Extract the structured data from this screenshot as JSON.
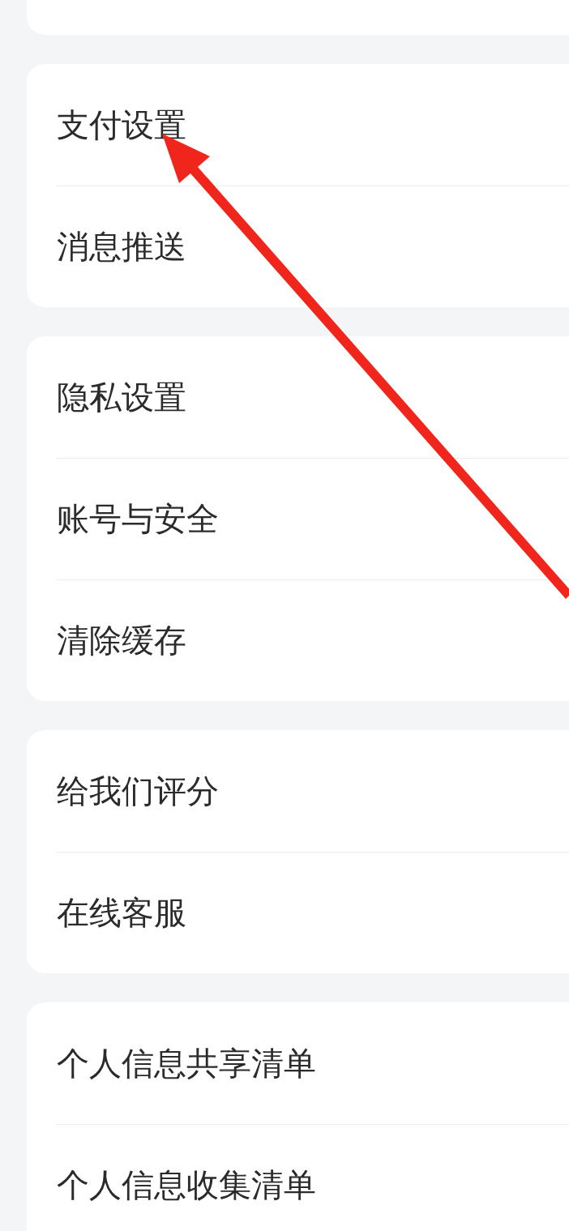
{
  "groups": [
    {
      "kind": "cut"
    },
    {
      "items": [
        {
          "label": "支付设置"
        },
        {
          "label": "消息推送"
        }
      ]
    },
    {
      "items": [
        {
          "label": "隐私设置"
        },
        {
          "label": "账号与安全"
        },
        {
          "label": "清除缓存"
        }
      ]
    },
    {
      "items": [
        {
          "label": "给我们评分"
        },
        {
          "label": "在线客服"
        }
      ]
    },
    {
      "items": [
        {
          "label": "个人信息共享清单"
        },
        {
          "label": "个人信息收集清单"
        }
      ]
    }
  ]
}
